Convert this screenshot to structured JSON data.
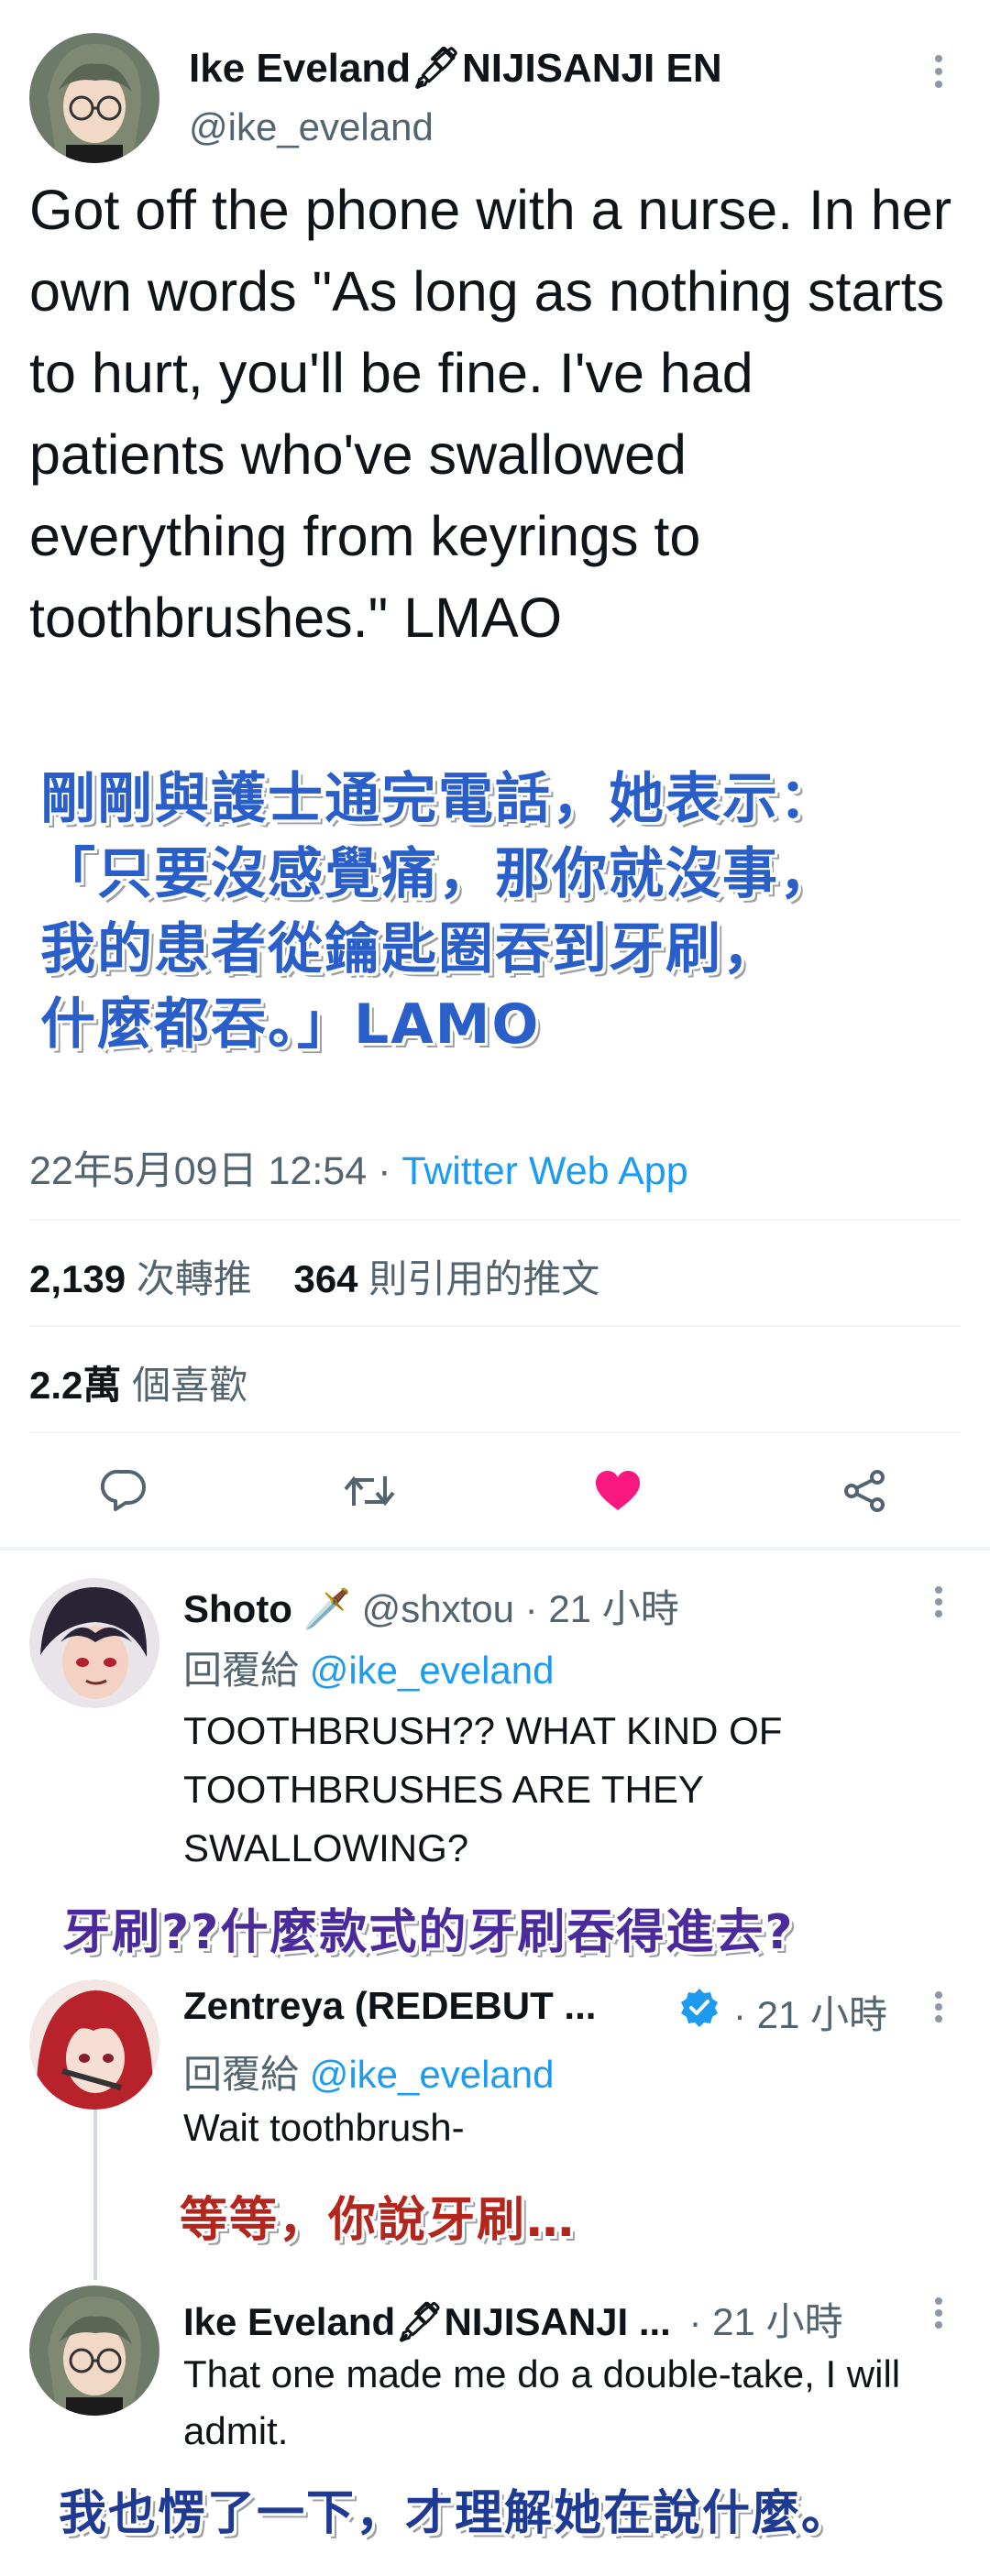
{
  "main_tweet": {
    "author_name": "Ike Eveland🖋NIJISANJI EN",
    "author_handle": "@ike_eveland",
    "text": "Got off the phone with a nurse. In her own words \"As long as nothing starts to hurt, you'll be fine. I've had patients who've swallowed everything from keyrings to toothbrushes.\" LMAO",
    "caption_lines": [
      "剛剛與護士通完電話，她表示：",
      "「只要沒感覺痛，那你就沒事，",
      "我的患者從鑰匙圈吞到牙刷，",
      "什麼都吞。」LAMO"
    ],
    "timestamp": "22年5月09日 12:54 · ",
    "source": "Twitter Web App",
    "retweets_count": "2,139",
    "retweets_label": "次轉推",
    "quotes_count": "364",
    "quotes_label": "則引用的推文",
    "likes_count": "2.2萬",
    "likes_label": "個喜歡"
  },
  "replies": [
    {
      "author_name": "Shoto",
      "author_emoji": "🗡️",
      "author_handle": "@shxtou",
      "time": "· 21 小時",
      "replying_to_label": "回覆給",
      "replying_to_handle": "@ike_eveland",
      "text": "TOOTHBRUSH?? WHAT KIND OF TOOTHBRUSHES ARE THEY SWALLOWING?",
      "caption": "牙刷??什麼款式的牙刷吞得進去?"
    },
    {
      "author_name": "Zentreya (REDEBUT ...",
      "author_handle": "",
      "time": "· 21 小時",
      "replying_to_label": "回覆給",
      "replying_to_handle": "@ike_eveland",
      "text": "Wait toothbrush-",
      "caption": "等等，你說牙刷…"
    },
    {
      "author_name": "Ike Eveland🖋NIJISANJI ...",
      "author_handle": "",
      "time": "· 21 小時",
      "text": "That one made me do a double-take, I will admit.",
      "caption": "我也愣了一下，才理解她在說什麼。"
    }
  ],
  "colors": {
    "accent": "#1d9bf0",
    "like": "#f91880",
    "muted": "#536471",
    "caption_blue": "#2a5fc9"
  },
  "icons": [
    "more-icon",
    "reply-icon",
    "retweet-icon",
    "heart-icon",
    "share-icon",
    "verified-icon"
  ]
}
